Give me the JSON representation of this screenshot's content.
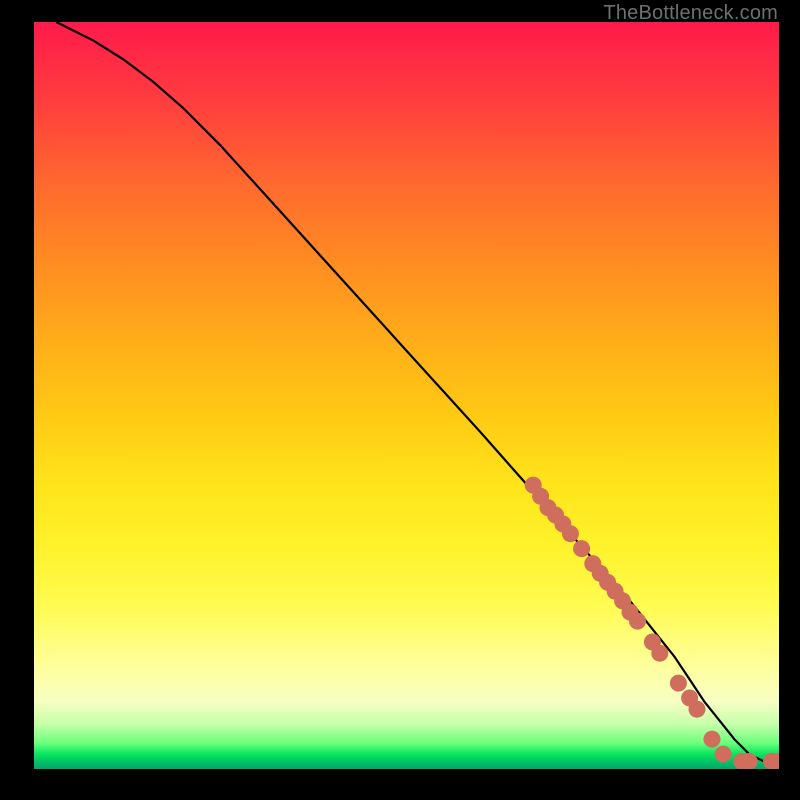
{
  "attribution": "TheBottleneck.com",
  "colors": {
    "marker": "#cf6e5d",
    "curve": "#000000",
    "background_frame": "#000000"
  },
  "chart_data": {
    "type": "line",
    "title": "",
    "xlabel": "",
    "ylabel": "",
    "xlim": [
      0,
      100
    ],
    "ylim": [
      0,
      100
    ],
    "grid": false,
    "legend": false,
    "series": [
      {
        "name": "curve",
        "x": [
          3,
          5,
          8,
          12,
          16,
          20,
          25,
          30,
          35,
          40,
          45,
          50,
          55,
          60,
          64,
          68,
          72,
          76,
          80,
          82,
          84,
          86,
          88,
          90,
          92,
          94,
          96,
          98,
          100
        ],
        "y": [
          100,
          99,
          97.5,
          95,
          92,
          88.5,
          83.5,
          78,
          72.5,
          67,
          61.5,
          56,
          50.5,
          45,
          40.5,
          36,
          31.5,
          27,
          22.5,
          20,
          17.5,
          15,
          12,
          9,
          6.5,
          4,
          2,
          1,
          1
        ]
      }
    ],
    "markers": [
      {
        "x": 67,
        "y": 38
      },
      {
        "x": 68,
        "y": 36.5
      },
      {
        "x": 69,
        "y": 35
      },
      {
        "x": 70,
        "y": 34
      },
      {
        "x": 71,
        "y": 32.8
      },
      {
        "x": 72,
        "y": 31.5
      },
      {
        "x": 73.5,
        "y": 29.5
      },
      {
        "x": 75,
        "y": 27.5
      },
      {
        "x": 76,
        "y": 26.2
      },
      {
        "x": 77,
        "y": 25
      },
      {
        "x": 78,
        "y": 23.8
      },
      {
        "x": 79,
        "y": 22.5
      },
      {
        "x": 80,
        "y": 21
      },
      {
        "x": 81,
        "y": 19.8
      },
      {
        "x": 83,
        "y": 17
      },
      {
        "x": 84,
        "y": 15.5
      },
      {
        "x": 86.5,
        "y": 11.5
      },
      {
        "x": 88,
        "y": 9.5
      },
      {
        "x": 89,
        "y": 8
      },
      {
        "x": 91,
        "y": 4
      },
      {
        "x": 92.5,
        "y": 2
      },
      {
        "x": 95,
        "y": 1
      },
      {
        "x": 96,
        "y": 1
      },
      {
        "x": 99,
        "y": 1
      },
      {
        "x": 100,
        "y": 1
      }
    ]
  }
}
